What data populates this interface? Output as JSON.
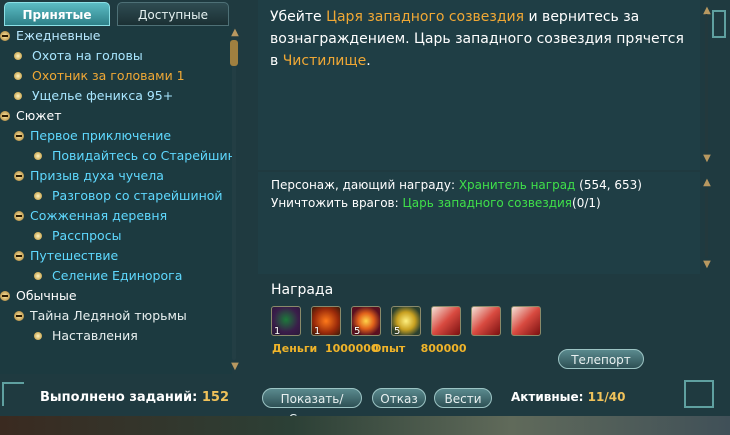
{
  "tabs": {
    "accepted": "Принятые",
    "available": "Доступные"
  },
  "tree": [
    {
      "label": "Ежедневные",
      "kind": "head",
      "icon": "minus"
    },
    {
      "label": "Охота на головы",
      "kind": "daily",
      "icon": "dot"
    },
    {
      "label": "Охотник за головами 1",
      "kind": "sel",
      "icon": "dot"
    },
    {
      "label": "Ущелье феникса 95+",
      "kind": "daily",
      "icon": "dot"
    },
    {
      "label": "Сюжет",
      "kind": "white",
      "icon": "minus"
    },
    {
      "label": "Первое приключение",
      "kind": "main",
      "icon": "minus"
    },
    {
      "label": "Повидайтесь со Старейшин",
      "kind": "sub",
      "icon": "dot"
    },
    {
      "label": "Призыв духа чучела",
      "kind": "main",
      "icon": "minus"
    },
    {
      "label": "Разговор со старейшиной",
      "kind": "sub",
      "icon": "dot"
    },
    {
      "label": "Сожженная деревня",
      "kind": "main",
      "icon": "minus"
    },
    {
      "label": "Расспросы",
      "kind": "sub",
      "icon": "dot"
    },
    {
      "label": "Путешествие",
      "kind": "main",
      "icon": "minus"
    },
    {
      "label": "Селение Единорога",
      "kind": "sub",
      "icon": "dot"
    },
    {
      "label": "Обычные",
      "kind": "white",
      "icon": "minus"
    },
    {
      "label": "Тайна Ледяной тюрьмы",
      "kind": "light",
      "icon": "minus"
    },
    {
      "label": "Наставления",
      "kind": "light",
      "icon": "dot"
    }
  ],
  "description": {
    "p1": "Убейте ",
    "p2": "Царя западного созвездия",
    "p3": " и вернитесь за вознаграждением. Царь западного созвездия прячется в ",
    "p4": "Чистилище",
    "p5": "."
  },
  "objectives": {
    "giver_label": "Персонаж, дающий награду: ",
    "giver_name": "Хранитель наград",
    "giver_coords": " (554, 653)",
    "kill_label": "Уничтожить врагов: ",
    "kill_name": "Царь западного созвездия",
    "kill_count": "(0/1)"
  },
  "reward": {
    "title": "Награда",
    "items": [
      {
        "qty": "1",
        "icon": "beetle-item-icon"
      },
      {
        "qty": "1",
        "icon": "chest-item-icon"
      },
      {
        "qty": "5",
        "icon": "red-orb-item-icon"
      },
      {
        "qty": "5",
        "icon": "gold-orb-item-icon"
      },
      {
        "qty": "",
        "icon": "scroll-item-icon"
      },
      {
        "qty": "",
        "icon": "scroll-item-icon"
      },
      {
        "qty": "",
        "icon": "scroll-item-icon"
      }
    ],
    "money_label": "Деньги",
    "money_value": "1000000",
    "exp_label": "Опыт",
    "exp_value": "800000",
    "teleport": "Телепорт"
  },
  "footer": {
    "done_label": "Выполнено заданий:",
    "done_value": "152",
    "show_hide": "Показать/Скрыть",
    "refuse": "Отказ",
    "news": "Вести",
    "active_label": "Активные:",
    "active_value": "11/40"
  }
}
